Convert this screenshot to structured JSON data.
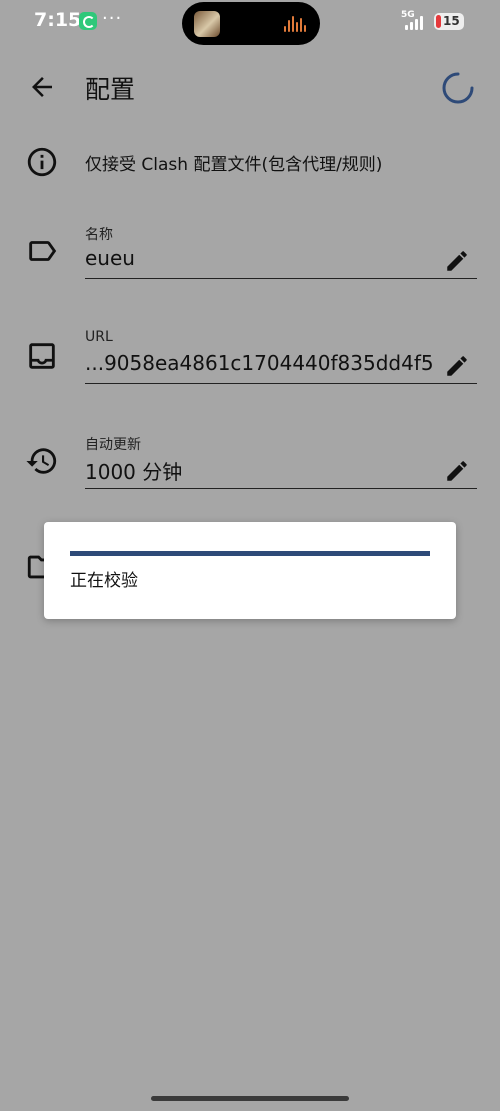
{
  "status_bar": {
    "time": "7:15",
    "dots": "···",
    "network": "5G",
    "battery": "15",
    "battery_color": "#e5383b"
  },
  "app_bar": {
    "title": "配置",
    "back_icon": "arrow-left",
    "loading_icon": "spinner"
  },
  "info": {
    "text": "仅接受 Clash 配置文件(包含代理/规则)",
    "icon": "info"
  },
  "fields": {
    "name": {
      "label": "名称",
      "value": "eueu",
      "icon": "label-tag"
    },
    "url": {
      "label": "URL",
      "value": "...9058ea4861c1704440f835dd4f5",
      "icon": "inbox-tray"
    },
    "auto_update": {
      "label": "自动更新",
      "value": "1000 分钟",
      "icon": "history"
    }
  },
  "dialog": {
    "text": "正在校验",
    "accent": "#2e4a78"
  },
  "colors": {
    "scrim_background": "#a6a6a6",
    "accent": "#2e4a78"
  }
}
